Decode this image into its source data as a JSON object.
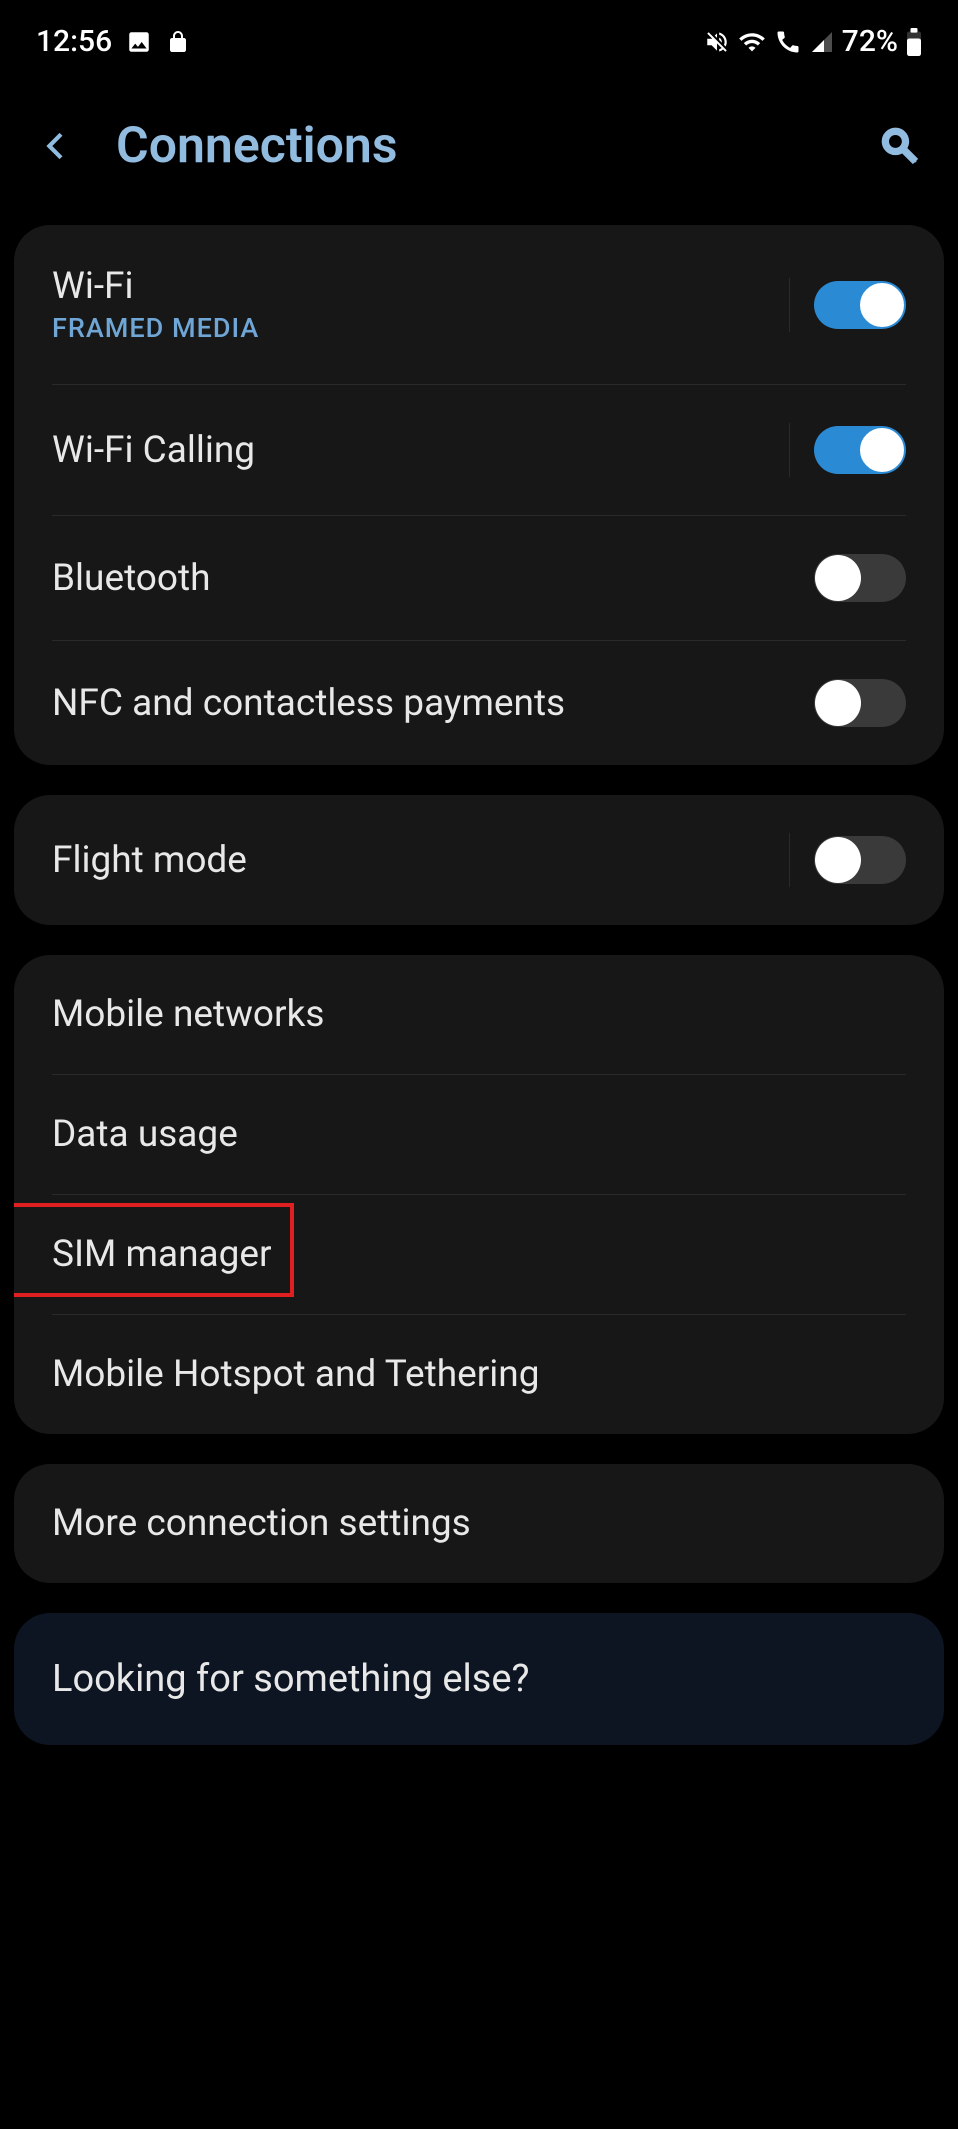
{
  "status": {
    "time": "12:56",
    "battery": "72%"
  },
  "header": {
    "title": "Connections"
  },
  "groups": [
    {
      "items": [
        {
          "title": "Wi-Fi",
          "subtitle": "FRAMED MEDIA",
          "toggle": true,
          "on": true,
          "withDivider": true
        },
        {
          "title": "Wi-Fi Calling",
          "toggle": true,
          "on": true,
          "withDivider": true
        },
        {
          "title": "Bluetooth",
          "toggle": true,
          "on": false,
          "withDivider": false
        },
        {
          "title": "NFC and contactless payments",
          "toggle": true,
          "on": false,
          "withDivider": false
        }
      ]
    },
    {
      "items": [
        {
          "title": "Flight mode",
          "toggle": true,
          "on": false,
          "withDivider": true
        }
      ]
    },
    {
      "items": [
        {
          "title": "Mobile networks",
          "toggle": false
        },
        {
          "title": "Data usage",
          "toggle": false
        },
        {
          "title": "SIM manager",
          "toggle": false,
          "highlighted": true
        },
        {
          "title": "Mobile Hotspot and Tethering",
          "toggle": false
        }
      ]
    },
    {
      "items": [
        {
          "title": "More connection settings",
          "toggle": false
        }
      ]
    }
  ],
  "footer": {
    "text": "Looking for something else?"
  }
}
